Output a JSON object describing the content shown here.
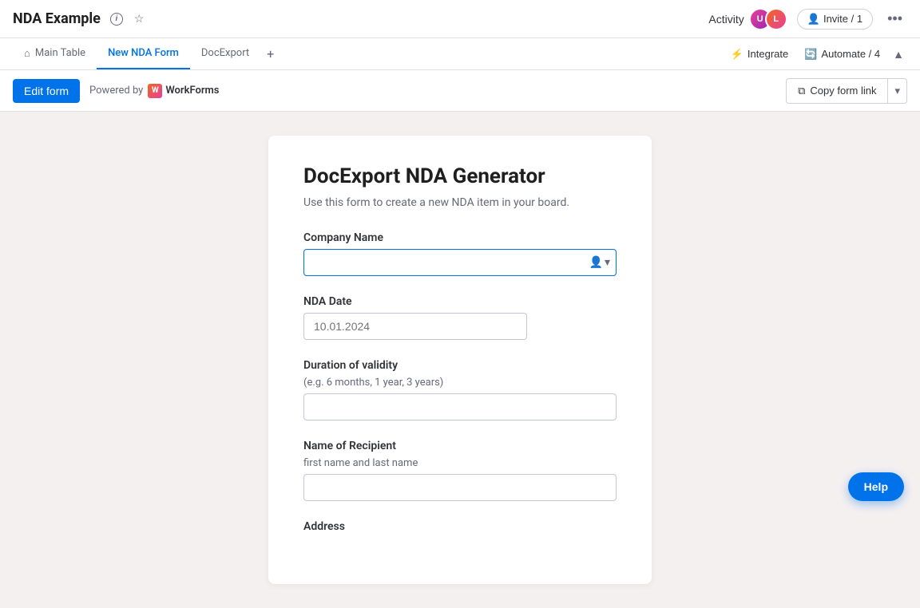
{
  "app": {
    "title": "NDA Example",
    "info_icon": "ℹ",
    "star_icon": "☆"
  },
  "header": {
    "activity_label": "Activity",
    "invite_label": "Invite / 1",
    "more_icon": "•••",
    "avatars": [
      "U",
      "L"
    ]
  },
  "tabs": {
    "items": [
      {
        "label": "Main Table",
        "icon": "⌂",
        "active": false
      },
      {
        "label": "New NDA Form",
        "icon": "",
        "active": true
      },
      {
        "label": "DocExport",
        "icon": "",
        "active": false
      }
    ],
    "add_label": "+",
    "integrate_label": "Integrate",
    "automate_label": "Automate / 4",
    "collapse_icon": "▲"
  },
  "form_toolbar": {
    "edit_form_label": "Edit form",
    "powered_by_label": "Powered by",
    "workforms_label": "WorkForms",
    "copy_link_icon": "⧉",
    "copy_link_label": "Copy form link",
    "dropdown_icon": "▾"
  },
  "form": {
    "title": "DocExport NDA Generator",
    "description": "Use this form to create a new NDA item in your board.",
    "fields": [
      {
        "id": "company_name",
        "label": "Company Name",
        "sublabel": "",
        "placeholder": "",
        "type": "text_with_icon",
        "active": true
      },
      {
        "id": "nda_date",
        "label": "NDA Date",
        "sublabel": "",
        "placeholder": "10.01.2024",
        "type": "date",
        "active": false
      },
      {
        "id": "duration_of_validity",
        "label": "Duration of validity",
        "sublabel": "(e.g. 6 months, 1 year, 3 years)",
        "placeholder": "",
        "type": "text",
        "active": false
      },
      {
        "id": "name_of_recipient",
        "label": "Name of Recipient",
        "sublabel": "first name and last name",
        "placeholder": "",
        "type": "text",
        "active": false
      },
      {
        "id": "address",
        "label": "Address",
        "sublabel": "",
        "placeholder": "",
        "type": "text",
        "active": false
      }
    ]
  },
  "help_btn": {
    "label": "Help"
  }
}
